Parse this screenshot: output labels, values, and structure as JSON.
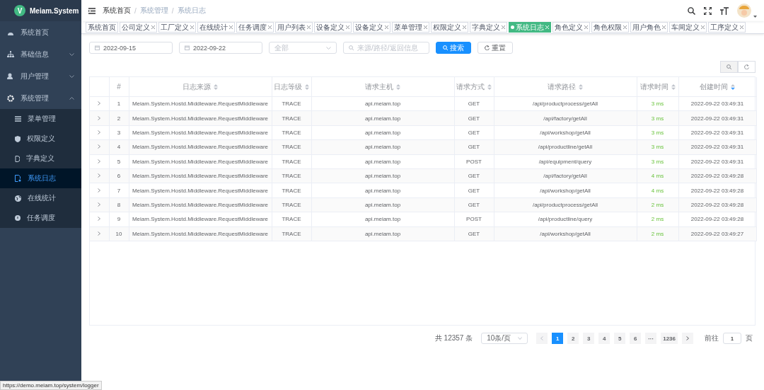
{
  "app": {
    "logo_letter": "V",
    "name": "Meiam.System"
  },
  "sidebar": {
    "items": [
      {
        "label": "系统首页",
        "kind": "link",
        "selected": false
      },
      {
        "label": "基础信息",
        "kind": "group",
        "expanded": false,
        "selected": false
      },
      {
        "label": "用户管理",
        "kind": "group",
        "expanded": false,
        "selected": false
      },
      {
        "label": "系统管理",
        "kind": "group",
        "expanded": true,
        "selected": false,
        "children": [
          {
            "label": "菜单管理",
            "selected": false
          },
          {
            "label": "权限定义",
            "selected": false
          },
          {
            "label": "字典定义",
            "selected": false
          },
          {
            "label": "系统日志",
            "selected": true
          },
          {
            "label": "在线统计",
            "selected": false
          },
          {
            "label": "任务调度",
            "selected": false
          }
        ]
      }
    ]
  },
  "breadcrumb": {
    "separator": "/",
    "items": [
      "系统首页",
      "系统管理",
      "系统日志"
    ]
  },
  "tags": [
    {
      "label": "系统首页",
      "closable": false,
      "selected": false
    },
    {
      "label": "公司定义",
      "closable": true,
      "selected": false
    },
    {
      "label": "工厂定义",
      "closable": true,
      "selected": false
    },
    {
      "label": "在线统计",
      "closable": true,
      "selected": false
    },
    {
      "label": "任务调度",
      "closable": true,
      "selected": false
    },
    {
      "label": "用户列表",
      "closable": true,
      "selected": false
    },
    {
      "label": "设备定义",
      "closable": true,
      "selected": false
    },
    {
      "label": "设备定义",
      "closable": true,
      "selected": false
    },
    {
      "label": "菜单管理",
      "closable": true,
      "selected": false
    },
    {
      "label": "权限定义",
      "closable": true,
      "selected": false
    },
    {
      "label": "字典定义",
      "closable": true,
      "selected": false
    },
    {
      "label": "系统日志",
      "closable": true,
      "selected": true
    },
    {
      "label": "角色定义",
      "closable": true,
      "selected": false
    },
    {
      "label": "角色权限",
      "closable": true,
      "selected": false
    },
    {
      "label": "用户角色",
      "closable": true,
      "selected": false
    },
    {
      "label": "车间定义",
      "closable": true,
      "selected": false
    },
    {
      "label": "工序定义",
      "closable": true,
      "selected": false
    }
  ],
  "filters": {
    "start_date": "2022-09-15",
    "end_date": "2022-09-22",
    "level": {
      "placeholder": "全部"
    },
    "keyword": {
      "placeholder": "来源/路径/返回信息"
    },
    "search_button": "搜索",
    "reset_button": "重置"
  },
  "toolbar": [
    {
      "kind": "search",
      "selected": true
    },
    {
      "kind": "refresh",
      "selected": false
    }
  ],
  "table": {
    "columns": [
      {
        "label": "#",
        "kind": "index",
        "sortable": false
      },
      {
        "label": "日志来源",
        "kind": "text",
        "sortable": true,
        "sorted_desc": false
      },
      {
        "label": "日志等级",
        "kind": "text",
        "sortable": true,
        "sorted_desc": false
      },
      {
        "label": "请求主机",
        "kind": "text",
        "sortable": true,
        "sorted_desc": false
      },
      {
        "label": "请求方式",
        "kind": "text",
        "sortable": true,
        "sorted_desc": false
      },
      {
        "label": "请求路径",
        "kind": "text",
        "sortable": true,
        "sorted_desc": false
      },
      {
        "label": "请求时间",
        "kind": "duration",
        "sortable": true,
        "sorted_desc": false
      },
      {
        "label": "创建时间",
        "kind": "text",
        "sortable": true,
        "sorted_desc": true
      }
    ],
    "rows": [
      {
        "expanded": false,
        "cells": [
          "1",
          "Meiam.System.Hostd.Middleware.RequestMiddleware",
          "TRACE",
          "api.meiam.top",
          "GET",
          "/api/productprocess/getAll",
          "3 ms",
          "2022-09-22 03:49:31"
        ]
      },
      {
        "expanded": false,
        "cells": [
          "2",
          "Meiam.System.Hostd.Middleware.RequestMiddleware",
          "TRACE",
          "api.meiam.top",
          "GET",
          "/api/factory/getAll",
          "3 ms",
          "2022-09-22 03:49:31"
        ]
      },
      {
        "expanded": false,
        "cells": [
          "3",
          "Meiam.System.Hostd.Middleware.RequestMiddleware",
          "TRACE",
          "api.meiam.top",
          "GET",
          "/api/workshop/getAll",
          "3 ms",
          "2022-09-22 03:49:31"
        ]
      },
      {
        "expanded": false,
        "cells": [
          "4",
          "Meiam.System.Hostd.Middleware.RequestMiddleware",
          "TRACE",
          "api.meiam.top",
          "GET",
          "/api/productline/getAll",
          "3 ms",
          "2022-09-22 03:49:31"
        ]
      },
      {
        "expanded": false,
        "cells": [
          "5",
          "Meiam.System.Hostd.Middleware.RequestMiddleware",
          "TRACE",
          "api.meiam.top",
          "POST",
          "/api/equipment/query",
          "3 ms",
          "2022-09-22 03:49:31"
        ]
      },
      {
        "expanded": false,
        "cells": [
          "6",
          "Meiam.System.Hostd.Middleware.RequestMiddleware",
          "TRACE",
          "api.meiam.top",
          "GET",
          "/api/factory/getAll",
          "4 ms",
          "2022-09-22 03:49:28"
        ]
      },
      {
        "expanded": false,
        "cells": [
          "7",
          "Meiam.System.Hostd.Middleware.RequestMiddleware",
          "TRACE",
          "api.meiam.top",
          "GET",
          "/api/workshop/getAll",
          "4 ms",
          "2022-09-22 03:49:28"
        ]
      },
      {
        "expanded": false,
        "cells": [
          "8",
          "Meiam.System.Hostd.Middleware.RequestMiddleware",
          "TRACE",
          "api.meiam.top",
          "GET",
          "/api/productprocess/getAll",
          "2 ms",
          "2022-09-22 03:49:28"
        ]
      },
      {
        "expanded": false,
        "cells": [
          "9",
          "Meiam.System.Hostd.Middleware.RequestMiddleware",
          "TRACE",
          "api.meiam.top",
          "POST",
          "/api/productline/query",
          "2 ms",
          "2022-09-22 03:49:28"
        ]
      },
      {
        "expanded": false,
        "cells": [
          "10",
          "Meiam.System.Hostd.Middleware.RequestMiddleware",
          "TRACE",
          "api.meiam.top",
          "GET",
          "/api/workshop/getAll",
          "2 ms",
          "2022-09-22 03:49:27"
        ]
      }
    ]
  },
  "pagination": {
    "total": "共 12357 条",
    "page_size": "10条/页",
    "prev": {
      "disabled": true
    },
    "next": {
      "disabled": false
    },
    "pages": [
      {
        "label": "1",
        "selected": true
      },
      {
        "label": "2",
        "selected": false
      },
      {
        "label": "3",
        "selected": false
      },
      {
        "label": "4",
        "selected": false
      },
      {
        "label": "5",
        "selected": false
      },
      {
        "label": "6",
        "selected": false
      },
      {
        "label": "···",
        "selected": false
      },
      {
        "label": "1236",
        "selected": false
      }
    ],
    "goto_label": "前往",
    "goto_value": "1",
    "goto_suffix": "页"
  },
  "status_url": "https://demo.meiam.top/system/logger"
}
